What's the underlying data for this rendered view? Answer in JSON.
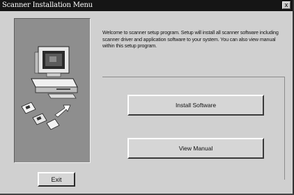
{
  "window": {
    "title": "Scanner Installation Menu",
    "close_glyph": "x"
  },
  "illustration": {
    "icon": "computer-with-disks-icon"
  },
  "welcome_text": "Welcome to scanner setup program. Setup will install all scanner software including scanner driver and application software to your system. You can also view manual within this setup program.",
  "buttons": {
    "install": "Install Software",
    "manual": "View Manual",
    "exit": "Exit"
  },
  "colors": {
    "titlebar": "#151515",
    "dialog_bg": "#d0d0d0",
    "panel_bg": "#8e8e8e"
  }
}
